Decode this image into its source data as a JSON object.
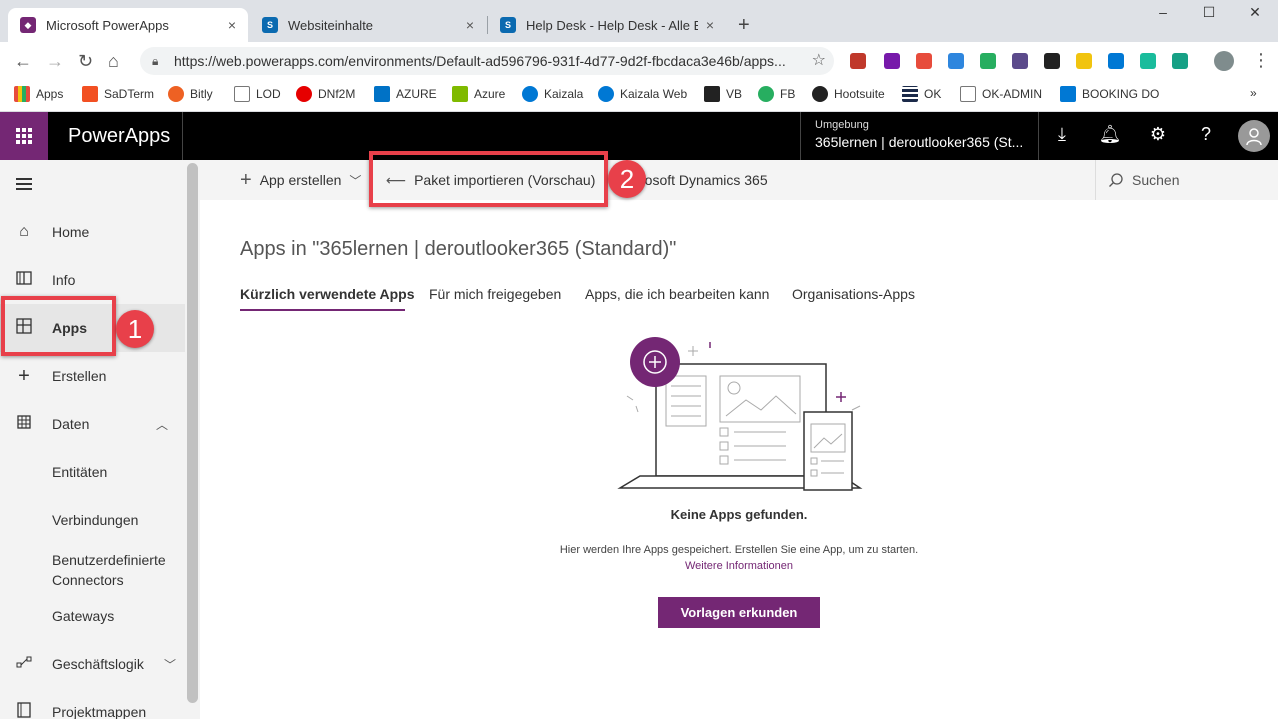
{
  "browser": {
    "tabs": [
      {
        "title": "Microsoft PowerApps",
        "close": "×"
      },
      {
        "title": "Websiteinhalte",
        "close": "×"
      },
      {
        "title": "Help Desk - Help Desk - Alle Elem",
        "close": "×"
      }
    ],
    "new_tab": "+",
    "window_controls": {
      "minimize": "–",
      "maximize": "☐",
      "close": "✕"
    },
    "url": "https://web.powerapps.com/environments/Default-ad596796-931f-4d77-9d2f-fbcdaca3e46b/apps...",
    "bookmarks": [
      "Apps",
      "SaDTerm",
      "Bitly",
      "LOD",
      "DNf2M",
      "AZURE",
      "Azure",
      "Kaizala",
      "Kaizala Web",
      "VB",
      "FB",
      "Hootsuite",
      "OK",
      "OK-ADMIN",
      "BOOKING DO"
    ],
    "bookmarks_more": "»"
  },
  "header": {
    "brand": "PowerApps",
    "environment_label": "Umgebung",
    "environment_name": "365lernen | deroutlooker365 (St..."
  },
  "sidebar": {
    "items": [
      {
        "label": "Home",
        "icon": "home-icon"
      },
      {
        "label": "Info",
        "icon": "book-icon"
      },
      {
        "label": "Apps",
        "icon": "apps-icon"
      },
      {
        "label": "Erstellen",
        "icon": "plus-icon"
      },
      {
        "label": "Daten",
        "icon": "table-icon"
      }
    ],
    "sub_items": [
      "Entitäten",
      "Verbindungen",
      "Benutzerdefinierte Connectors",
      "Gateways"
    ],
    "more_items": [
      {
        "label": "Geschäftslogik",
        "icon": "flow-icon"
      },
      {
        "label": "Projektmappen",
        "icon": "solutions-icon"
      }
    ]
  },
  "commandbar": {
    "create_app": "App erstellen",
    "import_package": "Paket importieren (Vorschau)",
    "dynamics": "rosoft Dynamics 365",
    "search": "Suchen"
  },
  "main": {
    "title": "Apps in \"365lernen | deroutlooker365 (Standard)\"",
    "tabs": [
      "Kürzlich verwendete Apps",
      "Für mich freigegeben",
      "Apps, die ich bearbeiten kann",
      "Organisations-Apps"
    ],
    "empty_title": "Keine Apps gefunden.",
    "empty_desc": "Hier werden Ihre Apps gespeichert. Erstellen Sie eine App, um zu starten.",
    "empty_link": "Weitere Informationen",
    "cta": "Vorlagen erkunden"
  },
  "annotations": {
    "badge1": "1",
    "badge2": "2"
  },
  "colors": {
    "brand": "#742774",
    "annotation": "#e8404a"
  }
}
